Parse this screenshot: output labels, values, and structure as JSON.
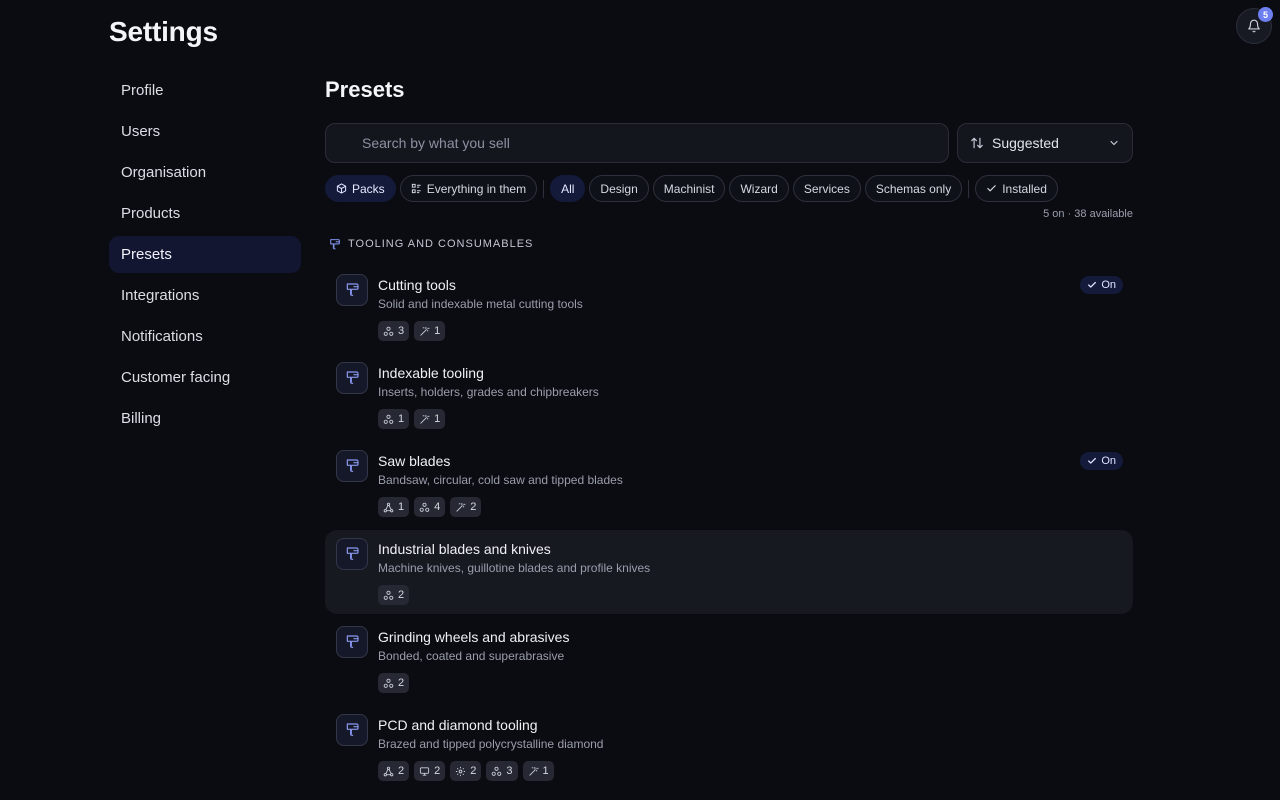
{
  "app": {
    "title": "Settings",
    "notifications_count": "5"
  },
  "sidebar": {
    "items": [
      {
        "label": "Profile",
        "active": false
      },
      {
        "label": "Users",
        "active": false
      },
      {
        "label": "Organisation",
        "active": false
      },
      {
        "label": "Products",
        "active": false
      },
      {
        "label": "Presets",
        "active": true
      },
      {
        "label": "Integrations",
        "active": false
      },
      {
        "label": "Notifications",
        "active": false
      },
      {
        "label": "Customer facing",
        "active": false
      },
      {
        "label": "Billing",
        "active": false
      }
    ]
  },
  "main": {
    "title": "Presets",
    "search": {
      "placeholder": "Search by what you sell",
      "value": ""
    },
    "sort": {
      "label": "Suggested"
    },
    "view_chips": [
      {
        "label": "Packs",
        "icon": "cube-icon",
        "active": true
      },
      {
        "label": "Everything in them",
        "icon": "list-icon",
        "active": false
      }
    ],
    "filter_chips": [
      {
        "label": "All",
        "active": true
      },
      {
        "label": "Design",
        "active": false
      },
      {
        "label": "Machinist",
        "active": false
      },
      {
        "label": "Wizard",
        "active": false
      },
      {
        "label": "Services",
        "active": false
      },
      {
        "label": "Schemas only",
        "active": false
      }
    ],
    "installed_chip": {
      "label": "Installed",
      "icon": "check-icon"
    },
    "count_text": "5 on · 38 available",
    "group": {
      "title": "TOOLING AND CONSUMABLES",
      "icon": "drill-icon",
      "items": [
        {
          "title": "Cutting tools",
          "description": "Solid and indexable metal cutting tools",
          "on": "On",
          "tags": [
            {
              "icon": "blocks-icon",
              "count": "3"
            },
            {
              "icon": "wand-icon",
              "count": "1"
            }
          ]
        },
        {
          "title": "Indexable tooling",
          "description": "Inserts, holders, grades and chipbreakers",
          "on": "",
          "tags": [
            {
              "icon": "blocks-icon",
              "count": "1"
            },
            {
              "icon": "wand-icon",
              "count": "1"
            }
          ]
        },
        {
          "title": "Saw blades",
          "description": "Bandsaw, circular, cold saw and tipped blades",
          "on": "On",
          "tags": [
            {
              "icon": "triangle-icon",
              "count": "1"
            },
            {
              "icon": "blocks-icon",
              "count": "4"
            },
            {
              "icon": "wand-icon",
              "count": "2"
            }
          ]
        },
        {
          "title": "Industrial blades and knives",
          "description": "Machine knives, guillotine blades and profile knives",
          "on": "",
          "tags": [
            {
              "icon": "blocks-icon",
              "count": "2"
            }
          ]
        },
        {
          "title": "Grinding wheels and abrasives",
          "description": "Bonded, coated and superabrasive",
          "on": "",
          "tags": [
            {
              "icon": "blocks-icon",
              "count": "2"
            }
          ]
        },
        {
          "title": "PCD and diamond tooling",
          "description": "Brazed and tipped polycrystalline diamond",
          "on": "",
          "tags": [
            {
              "icon": "triangle-icon",
              "count": "2"
            },
            {
              "icon": "monitor-icon",
              "count": "2"
            },
            {
              "icon": "gear-icon",
              "count": "2"
            },
            {
              "icon": "blocks-icon",
              "count": "3"
            },
            {
              "icon": "wand-icon",
              "count": "1"
            }
          ]
        }
      ]
    }
  }
}
